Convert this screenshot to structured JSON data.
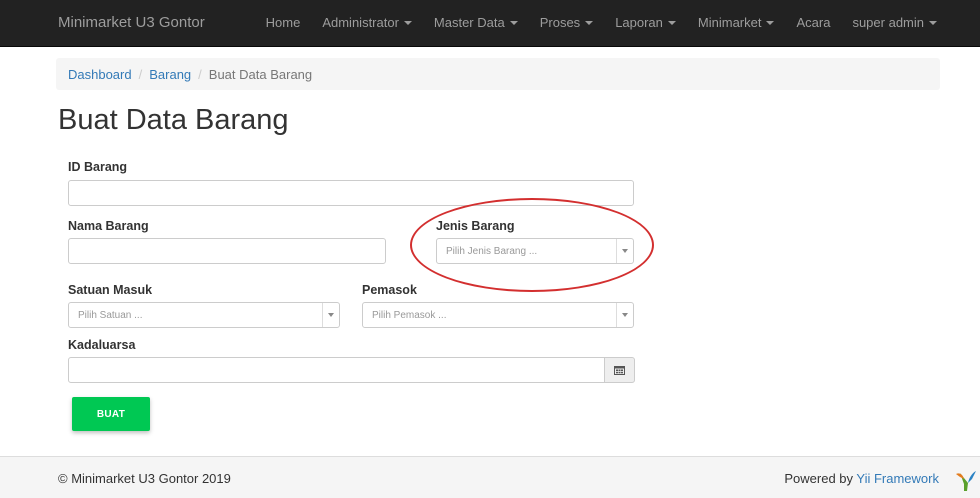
{
  "navbar": {
    "brand": "Minimarket U3 Gontor",
    "items": [
      {
        "label": "Home",
        "dropdown": false
      },
      {
        "label": "Administrator",
        "dropdown": true
      },
      {
        "label": "Master Data",
        "dropdown": true
      },
      {
        "label": "Proses",
        "dropdown": true
      },
      {
        "label": "Laporan",
        "dropdown": true
      },
      {
        "label": "Minimarket",
        "dropdown": true
      },
      {
        "label": "Acara",
        "dropdown": false
      },
      {
        "label": "super admin",
        "dropdown": true
      }
    ]
  },
  "breadcrumb": {
    "items": [
      "Dashboard",
      "Barang"
    ],
    "active": "Buat Data Barang",
    "separator": "/"
  },
  "page": {
    "title": "Buat Data Barang"
  },
  "form": {
    "id_barang": {
      "label": "ID Barang",
      "value": ""
    },
    "nama_barang": {
      "label": "Nama Barang",
      "value": ""
    },
    "jenis_barang": {
      "label": "Jenis Barang",
      "placeholder": "Pilih Jenis Barang ..."
    },
    "satuan_masuk": {
      "label": "Satuan Masuk",
      "placeholder": "Pilih Satuan ..."
    },
    "pemasok": {
      "label": "Pemasok",
      "placeholder": "Pilih Pemasok ..."
    },
    "kadaluarsa": {
      "label": "Kadaluarsa",
      "value": "",
      "icon": "calendar-icon"
    },
    "submit_label": "BUAT"
  },
  "footer": {
    "copyright": "© Minimarket U3 Gontor 2019",
    "powered_prefix": "Powered by",
    "powered_link": "Yii Framework",
    "logo": "yii-logo"
  },
  "colors": {
    "navbar_bg": "#222222",
    "nav_text": "#9d9d9d",
    "link": "#337ab7",
    "submit_button": "#00c853",
    "annotation_ellipse": "#d32f2f"
  }
}
